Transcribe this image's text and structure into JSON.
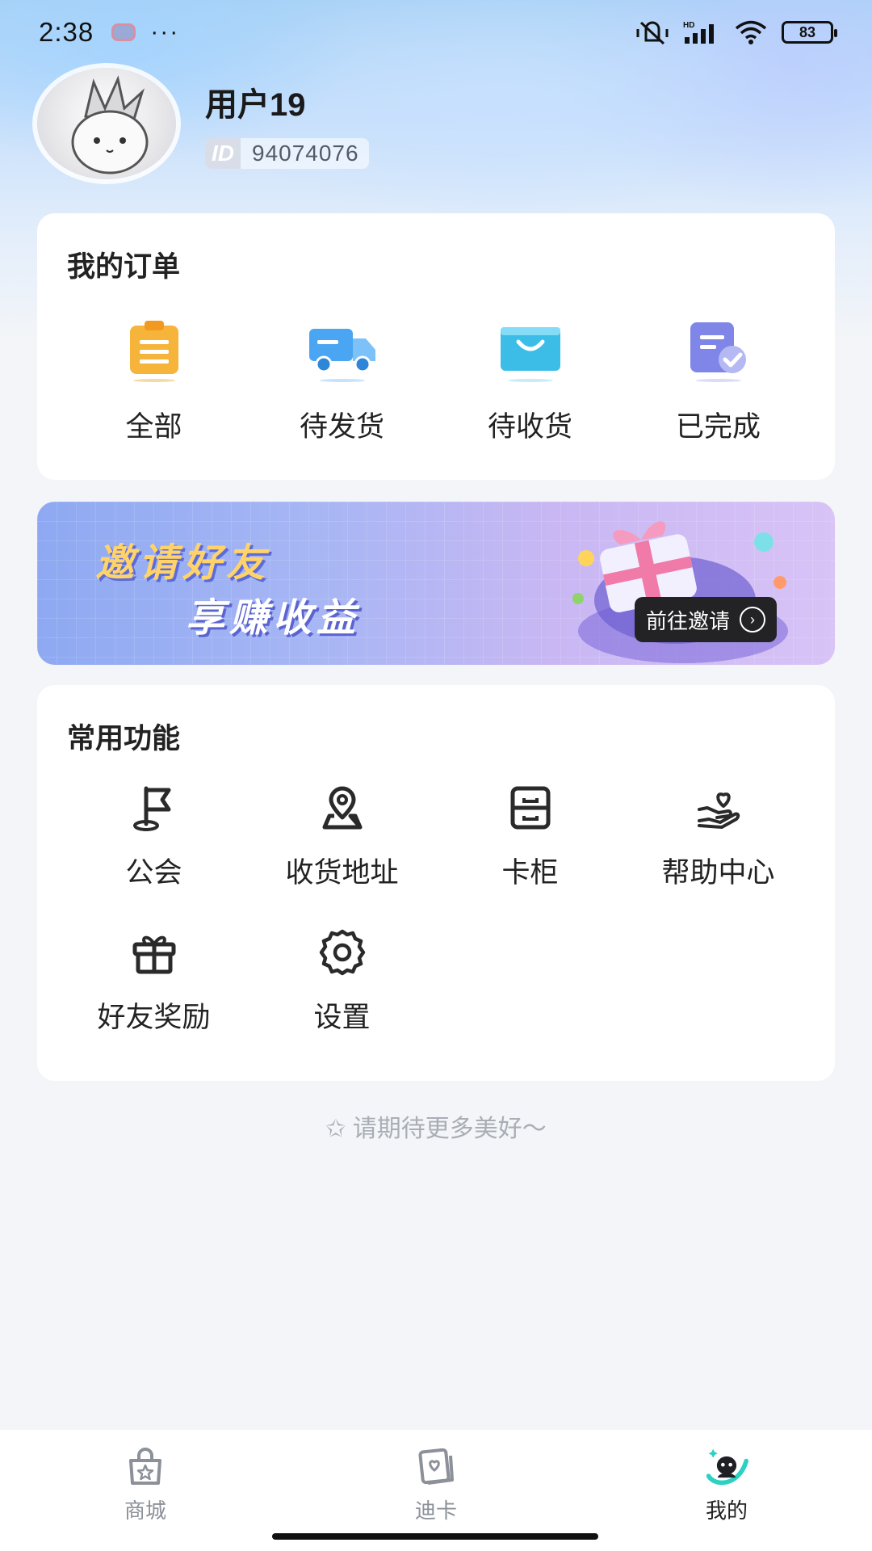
{
  "status_bar": {
    "time": "2:38",
    "dots": "···",
    "battery": "83"
  },
  "profile": {
    "username": "用户19",
    "id_tag": "ID",
    "id_value": "94074076"
  },
  "orders": {
    "title": "我的订单",
    "items": [
      {
        "label": "全部",
        "icon": "clipboard-icon"
      },
      {
        "label": "待发货",
        "icon": "truck-icon"
      },
      {
        "label": "待收货",
        "icon": "shopping-bag-icon"
      },
      {
        "label": "已完成",
        "icon": "completed-doc-icon"
      }
    ]
  },
  "banner": {
    "line1": "邀请好友",
    "line2": "享赚收益",
    "cta": "前往邀请"
  },
  "functions": {
    "title": "常用功能",
    "items": [
      {
        "label": "公会",
        "icon": "flag-icon"
      },
      {
        "label": "收货地址",
        "icon": "location-pin-icon"
      },
      {
        "label": "卡柜",
        "icon": "cabinet-icon"
      },
      {
        "label": "帮助中心",
        "icon": "helping-hand-heart-icon"
      },
      {
        "label": "好友奖励",
        "icon": "gift-icon"
      },
      {
        "label": "设置",
        "icon": "gear-icon"
      }
    ]
  },
  "footer_note": "✩ 请期待更多美好～",
  "tabbar": {
    "items": [
      {
        "label": "商城",
        "icon": "shop-bag-star-icon",
        "active": false
      },
      {
        "label": "迪卡",
        "icon": "card-heart-icon",
        "active": false
      },
      {
        "label": "我的",
        "icon": "profile-mascot-icon",
        "active": true
      }
    ]
  },
  "colors": {
    "accent_teal": "#2bd1c2",
    "card_bg": "#ffffff",
    "page_bg": "#f3f5f8"
  }
}
